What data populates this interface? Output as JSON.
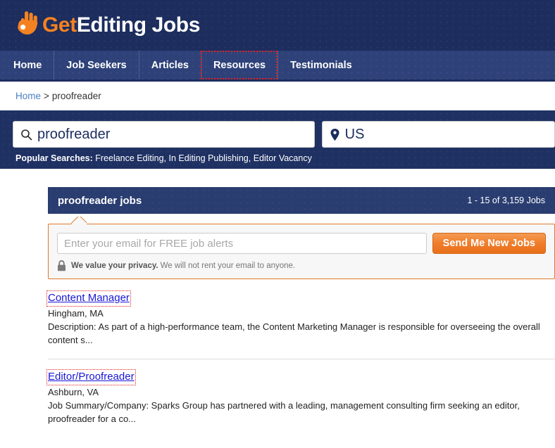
{
  "brand": {
    "logo_icon": "ok-hand-icon",
    "name_accent": "Get",
    "name_rest": "Editing Jobs",
    "accent_color": "#f58220",
    "header_bg": "#1c2d5e"
  },
  "nav": {
    "items": [
      {
        "label": "Home",
        "focused": false
      },
      {
        "label": "Job Seekers",
        "focused": false
      },
      {
        "label": "Articles",
        "focused": false
      },
      {
        "label": "Resources",
        "focused": true
      },
      {
        "label": "Testimonials",
        "focused": false
      }
    ]
  },
  "breadcrumb": {
    "home_label": "Home",
    "separator": ">",
    "current": "proofreader"
  },
  "search": {
    "keyword_icon": "search-icon",
    "keyword_value": "proofreader",
    "location_icon": "map-pin-icon",
    "location_value": "US",
    "popular_label": "Popular Searches:",
    "popular_terms": "Freelance Editing, In Editing Publishing, Editor Vacancy"
  },
  "results": {
    "title": "proofreader jobs",
    "count_text": "1 - 15 of 3,159 Jobs"
  },
  "alert": {
    "email_placeholder": "Enter your email for FREE job alerts",
    "email_value": "",
    "button_label": "Send Me New Jobs",
    "button_color": "#ef7e2c",
    "lock_icon": "lock-icon",
    "privacy_strong": "We value your privacy.",
    "privacy_text": "We will not rent your email to anyone."
  },
  "jobs": [
    {
      "title": "Content Manager",
      "focused": true,
      "location": "Hingham, MA",
      "description": "Description: As part of a high-performance team, the Content Marketing Manager is responsible for overseeing the overall content s..."
    },
    {
      "title": "Editor/Proofreader",
      "focused": true,
      "location": "Ashburn, VA",
      "description": "Job Summary/Company: Sparks Group has partnered with a leading, management consulting firm seeking an editor, proofreader for a co..."
    }
  ]
}
